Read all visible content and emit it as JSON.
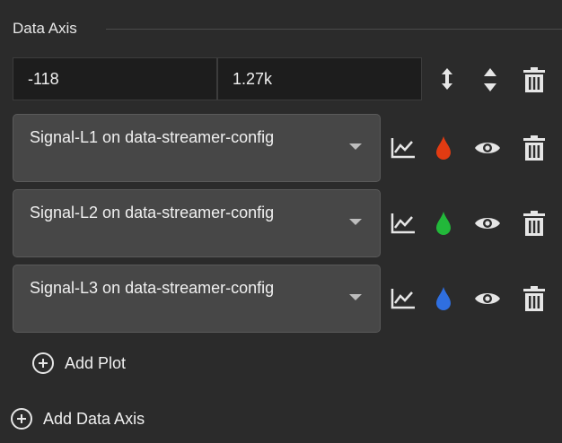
{
  "section": {
    "title": "Data Axis"
  },
  "range": {
    "min": "-118",
    "max": "1.27k"
  },
  "plots": [
    {
      "label": "Signal-L1 on data-streamer-config",
      "color": "#e23b12"
    },
    {
      "label": "Signal-L2 on data-streamer-config",
      "color": "#22b83a"
    },
    {
      "label": "Signal-L3 on data-streamer-config",
      "color": "#2f6fe0"
    }
  ],
  "actions": {
    "add_plot": "Add Plot",
    "add_data_axis": "Add Data Axis"
  },
  "icons": {
    "expand": "expand-vertical-icon",
    "sort": "sort-up-down-icon",
    "delete": "trash-icon",
    "chart": "line-chart-icon",
    "color": "color-drop-icon",
    "visibility": "eye-icon"
  }
}
